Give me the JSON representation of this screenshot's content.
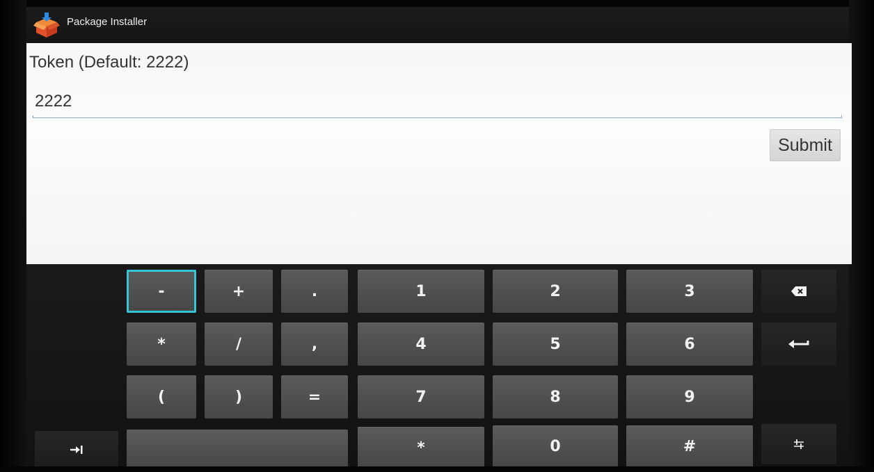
{
  "app": {
    "title": "Package Installer",
    "icon": "package-box-icon"
  },
  "form": {
    "token_label": "Token (Default: 2222)",
    "token_value": "2222",
    "token_placeholder": "",
    "submit_label": "Submit"
  },
  "keyboard": {
    "row1": [
      "-",
      "+",
      ".",
      "1",
      "2",
      "3"
    ],
    "row2": [
      "*",
      "/",
      ",",
      "4",
      "5",
      "6"
    ],
    "row3": [
      "(",
      ")",
      "=",
      "7",
      "8",
      "9"
    ],
    "row4": [
      "*",
      "0",
      "#"
    ],
    "icons": {
      "backspace": "backspace-icon",
      "enter": "enter-icon",
      "tab": "tab-icon",
      "settings": "keyboard-settings-icon"
    },
    "focused_key": "-"
  },
  "colors": {
    "focus_ring": "#35c6d6",
    "input_underline": "#7aa7c3",
    "key_face": "#505050",
    "panel_bg": "#f9f9f9"
  }
}
